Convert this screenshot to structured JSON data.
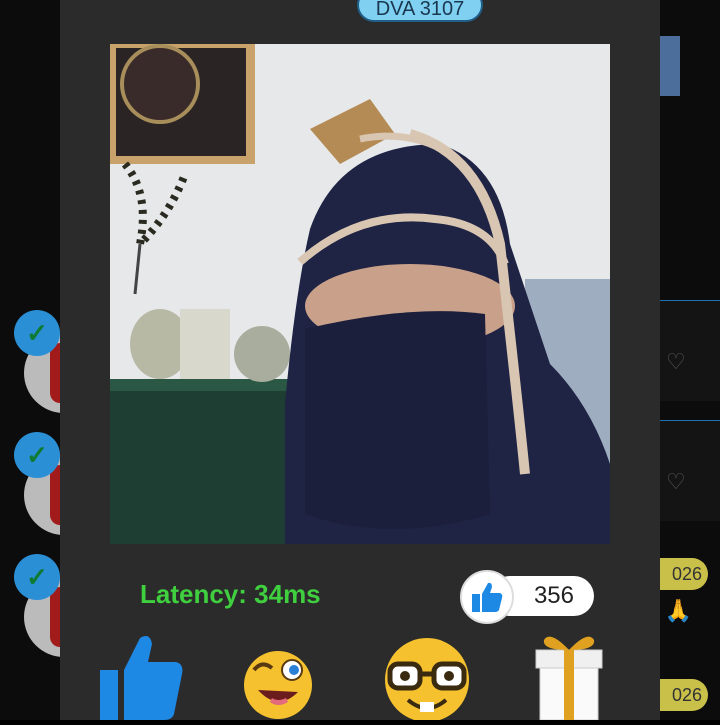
{
  "room": {
    "title": "DVA 3107"
  },
  "stats": {
    "latency": "Latency: 34ms",
    "likes": "356"
  },
  "background": {
    "pills": [
      "026",
      "026"
    ],
    "icons": [
      "verified-badge",
      "heart-icon",
      "pray-icon"
    ]
  },
  "reactions": [
    "thumbs-up-reaction",
    "winking-face-reaction",
    "nerd-face-reaction",
    "gift-reaction"
  ],
  "colors": {
    "latency": "#3fcf3f",
    "title_pill": "#7fd0f1",
    "like_blue": "#1e88e5",
    "modal": "#2b2b2b"
  }
}
